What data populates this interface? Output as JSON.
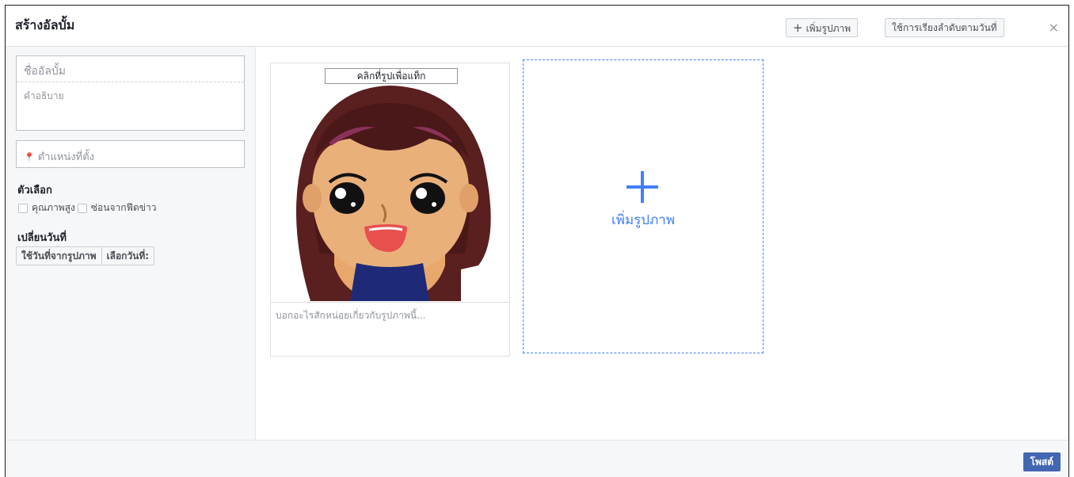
{
  "header": {
    "title": "สร้างอัลบั้ม",
    "add_photo_label": "เพิ่มรูปภาพ",
    "sort_label": "ใช้การเรียงลำดับตามวันที่",
    "close_symbol": "×"
  },
  "sidebar": {
    "album_name_placeholder": "ชื่ออัลบั้ม",
    "description_placeholder": "คำอธิบาย",
    "location_placeholder": "ตำแหน่งที่ตั้ง",
    "options_heading": "ตัวเลือก",
    "high_quality_label": "คุณภาพสูง",
    "hide_from_feed_label": "ซ่อนจากฟีดข่าว",
    "change_date_heading": "เปลี่ยนวันที่",
    "use_photo_date_label": "ใช้วันที่จากรูปภาพ",
    "choose_date_label": "เลือกวันที่:"
  },
  "photo_card": {
    "tag_hint": "คลิกที่รูปเพื่อแท็ก",
    "caption_placeholder": "บอกอะไรสักหน่อยเกี่ยวกับรูปภาพนี้..."
  },
  "add_tile": {
    "label": "เพิ่มรูปภาพ"
  },
  "footer": {
    "post_label": "โพสต์"
  },
  "colors": {
    "accent": "#4080ff",
    "post_button": "#4267b2"
  }
}
